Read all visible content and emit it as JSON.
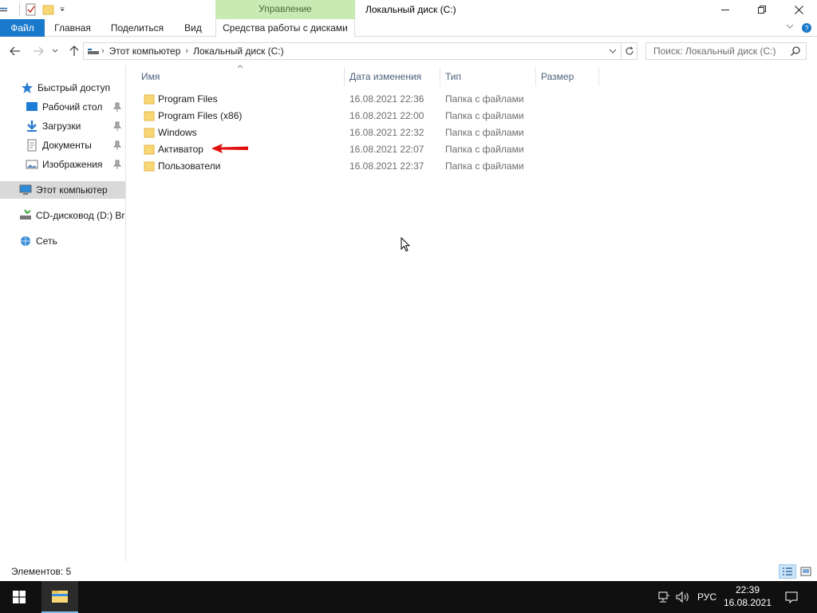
{
  "window": {
    "title": "Локальный диск (C:)",
    "contextual_group": "Управление"
  },
  "ribbon": {
    "tabs": [
      {
        "label": "Файл"
      },
      {
        "label": "Главная"
      },
      {
        "label": "Поделиться"
      },
      {
        "label": "Вид"
      },
      {
        "label": "Средства работы с дисками"
      }
    ]
  },
  "address": {
    "breadcrumbs": [
      "Этот компьютер",
      "Локальный диск (C:)"
    ],
    "search_placeholder": "Поиск: Локальный диск (C:)"
  },
  "nav": {
    "items": [
      {
        "label": "Быстрый доступ",
        "icon": "star-icon",
        "pinned": false
      },
      {
        "label": "Рабочий стол",
        "icon": "desktop-icon",
        "pinned": true
      },
      {
        "label": "Загрузки",
        "icon": "download-icon",
        "pinned": true
      },
      {
        "label": "Документы",
        "icon": "documents-icon",
        "pinned": true
      },
      {
        "label": "Изображения",
        "icon": "pictures-icon",
        "pinned": true
      },
      {
        "label": "Этот компьютер",
        "icon": "computer-icon",
        "pinned": false,
        "selected": true
      },
      {
        "label": "CD-дисковод (D:) Bru",
        "icon": "cd-drive-icon",
        "pinned": false
      },
      {
        "label": "Сеть",
        "icon": "network-icon",
        "pinned": false
      }
    ]
  },
  "files": {
    "columns": [
      "Имя",
      "Дата изменения",
      "Тип",
      "Размер"
    ],
    "rows": [
      {
        "name": "Program Files",
        "date": "16.08.2021 22:36",
        "type": "Папка с файлами",
        "size": ""
      },
      {
        "name": "Program Files (x86)",
        "date": "16.08.2021 22:00",
        "type": "Папка с файлами",
        "size": ""
      },
      {
        "name": "Windows",
        "date": "16.08.2021 22:32",
        "type": "Папка с файлами",
        "size": ""
      },
      {
        "name": "Активатор",
        "date": "16.08.2021 22:07",
        "type": "Папка с файлами",
        "size": ""
      },
      {
        "name": "Пользователи",
        "date": "16.08.2021 22:37",
        "type": "Папка с файлами",
        "size": ""
      }
    ]
  },
  "status": {
    "count": "Элементов: 5"
  },
  "taskbar": {
    "language": "РУС",
    "time": "22:39",
    "date": "16.08.2021"
  },
  "colors": {
    "file_tab": "#1979ca",
    "manage_tab": "#c8eab3",
    "folder": "#f8d775",
    "annotation_arrow": "#e01010",
    "taskbar": "#101010"
  }
}
